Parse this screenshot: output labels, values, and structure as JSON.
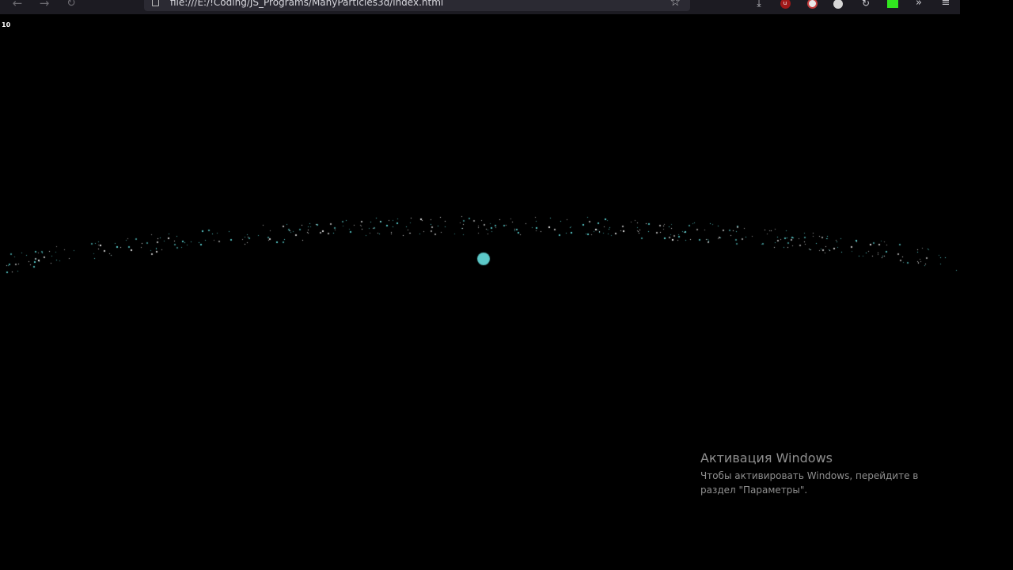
{
  "browser": {
    "back_icon": "←",
    "forward_icon": "→",
    "reload_icon": "↻",
    "url": "file:///E:/!Coding/JS_Programs/ManyParticles3d/index.html",
    "bookmark_icon": "☆",
    "toolbar": {
      "download_icon": "⤓",
      "ublock_label": "u",
      "sync_icon": "↻",
      "overflow_icon": "»",
      "menu_icon": "≡"
    }
  },
  "app": {
    "fps": "10",
    "colors": {
      "background": "#000000",
      "particle_cyan": "#5ad0d0",
      "particle_white": "#e8e8e8",
      "orb": "#5cc9c9"
    }
  },
  "windows_activation": {
    "title": "Активация Windows",
    "body": "Чтобы активировать Windows, перейдите в раздел \"Параметры\"."
  }
}
